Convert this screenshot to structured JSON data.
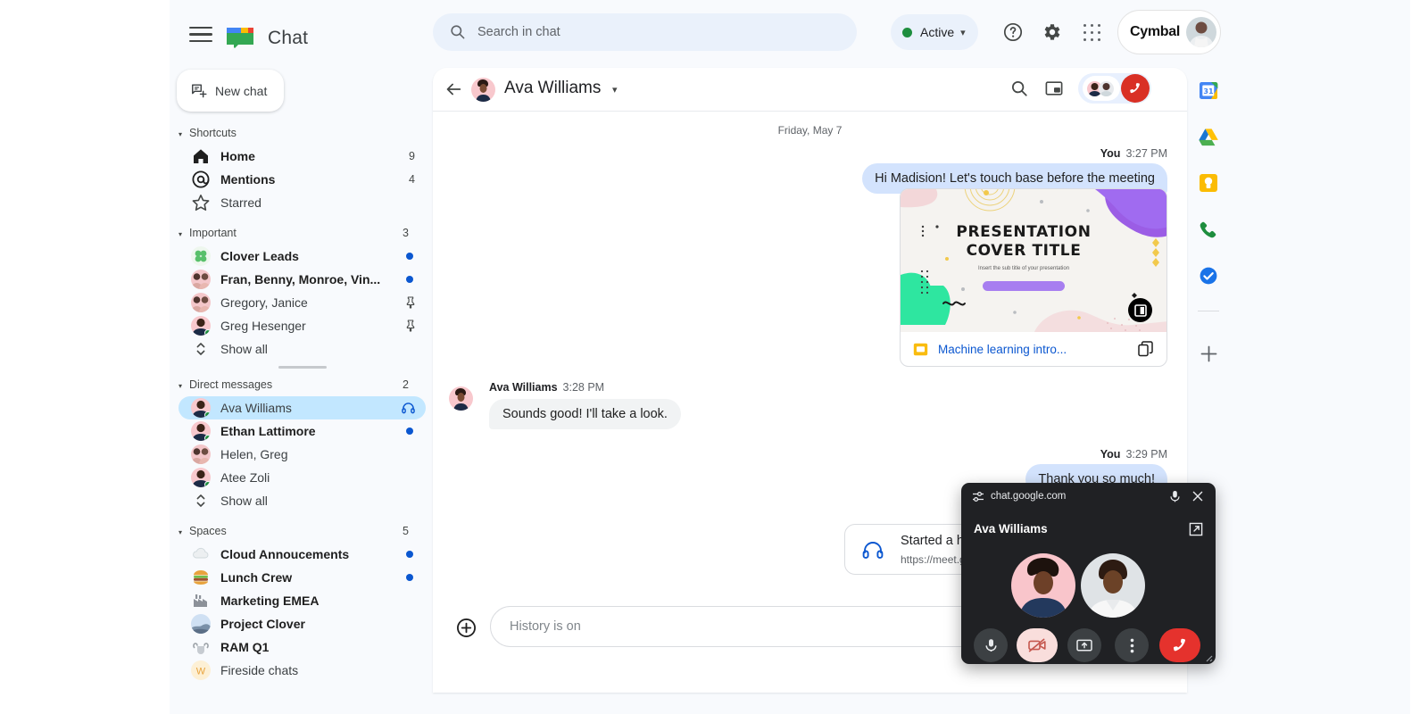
{
  "topbar": {
    "app_title": "Chat",
    "search_placeholder": "Search in chat",
    "status_label": "Active",
    "account_brand": "Cymbal",
    "icons": {
      "menu": "hamburger-icon",
      "logo": "google-chat-logo",
      "search": "search-icon",
      "help": "help-icon",
      "settings": "gear-icon",
      "apps": "apps-grid-icon",
      "status_caret": "chevron-down-icon"
    },
    "accent_blue": "#0b57d0",
    "status_green": "#1e8e3e"
  },
  "leftnav": {
    "new_chat_label": "New chat",
    "sections": [
      {
        "title": "Shortcuts",
        "count": "",
        "items": [
          {
            "label": "Home",
            "right": "9",
            "icon": "home-icon",
            "bold": true
          },
          {
            "label": "Mentions",
            "right": "4",
            "icon": "at-mention-icon",
            "bold": true
          },
          {
            "label": "Starred",
            "right": "",
            "icon": "star-icon",
            "bold": false
          }
        ]
      },
      {
        "title": "Important",
        "count": "3",
        "items": [
          {
            "label": "Clover Leads",
            "right": "",
            "icon": "clover-avatar",
            "bold": true,
            "unread": true
          },
          {
            "label": "Fran, Benny, Monroe, Vin...",
            "right": "",
            "icon": "group-avatar",
            "bold": true,
            "unread": true
          },
          {
            "label": "Gregory, Janice",
            "right": "",
            "icon": "group-avatar",
            "bold": false,
            "pinned": true
          },
          {
            "label": "Greg Hesenger",
            "right": "",
            "icon": "person-avatar",
            "bold": false,
            "pinned": true
          },
          {
            "label": "Show all",
            "right": "",
            "icon": "expand-icon",
            "bold": false
          }
        ]
      },
      {
        "title": "Direct messages",
        "count": "2",
        "items": [
          {
            "label": "Ava Williams",
            "right": "",
            "icon": "person-avatar",
            "bold": false,
            "selected": true,
            "headset": true
          },
          {
            "label": "Ethan Lattimore",
            "right": "",
            "icon": "person-avatar",
            "bold": true,
            "unread": true
          },
          {
            "label": "Helen, Greg",
            "right": "",
            "icon": "group-avatar",
            "bold": false
          },
          {
            "label": "Atee Zoli",
            "right": "",
            "icon": "person-avatar",
            "bold": false
          },
          {
            "label": "Show all",
            "right": "",
            "icon": "expand-icon",
            "bold": false
          }
        ]
      },
      {
        "title": "Spaces",
        "count": "5",
        "items": [
          {
            "label": "Cloud Annoucements",
            "right": "",
            "icon": "cloud-emoji",
            "bold": true,
            "unread": true
          },
          {
            "label": "Lunch Crew",
            "right": "",
            "icon": "burger-emoji",
            "bold": true,
            "unread": true
          },
          {
            "label": "Marketing EMEA",
            "right": "",
            "icon": "factory-emoji",
            "bold": true
          },
          {
            "label": "Project Clover",
            "right": "",
            "icon": "space-image",
            "bold": true
          },
          {
            "label": "RAM Q1",
            "right": "",
            "icon": "ram-emoji",
            "bold": true
          },
          {
            "label": "Fireside chats",
            "right": "",
            "icon": "letter-w-avatar",
            "bold": false
          }
        ]
      }
    ]
  },
  "pane": {
    "header": {
      "title": "Ava Williams",
      "back_icon": "back-arrow-icon",
      "search_icon": "search-icon",
      "pip_icon": "picture-in-picture-icon",
      "caret_icon": "chevron-down-icon",
      "end_call_icon": "end-call-icon"
    },
    "day_separator": "Friday, May 7",
    "messages": [
      {
        "author": "You",
        "time": "3:27 PM",
        "text": "Hi Madision! Let's touch base before the meeting",
        "side": "out"
      },
      {
        "author": "Ava Williams",
        "time": "3:28 PM",
        "text": "Sounds good! I'll take a look.",
        "side": "in"
      },
      {
        "author": "You",
        "time": "3:29 PM",
        "text": "Thank you so much!",
        "side": "out"
      }
    ],
    "slide_card": {
      "slide_title_line1": "PRESENTATION",
      "slide_title_line2": "COVER TITLE",
      "slide_subtitle": "Insert the sub title of your presentation",
      "file_name": "Machine learning intro...",
      "file_icon": "google-slides-icon",
      "copy_icon": "copy-icon",
      "link_color": "#0b57d0"
    },
    "huddle_card": {
      "title": "Started a hu",
      "link": "https://meet.go",
      "icon": "headset-icon"
    },
    "compose": {
      "placeholder": "History is on",
      "plus_icon": "plus-circle-icon"
    }
  },
  "rail": {
    "items": [
      {
        "name": "calendar-icon",
        "label": "31"
      },
      {
        "name": "drive-icon",
        "label": ""
      },
      {
        "name": "keep-icon",
        "label": ""
      },
      {
        "name": "voice-icon",
        "label": ""
      },
      {
        "name": "tasks-icon",
        "label": ""
      }
    ],
    "add_label": "+"
  },
  "pip": {
    "url": "chat.google.com",
    "title": "Ava Williams",
    "lock_icon": "site-settings-icon",
    "mic_top_icon": "microphone-icon",
    "close_icon": "close-icon",
    "expand_icon": "open-in-new-icon",
    "controls": [
      {
        "name": "mic-button",
        "icon": "microphone-icon"
      },
      {
        "name": "camera-off-button",
        "icon": "camera-off-icon"
      },
      {
        "name": "present-button",
        "icon": "present-screen-icon"
      },
      {
        "name": "more-options-button",
        "icon": "more-vert-icon"
      },
      {
        "name": "hangup-button",
        "icon": "end-call-icon"
      }
    ],
    "hangup_color": "#e5322d",
    "camoff_color": "#f9dedc"
  }
}
